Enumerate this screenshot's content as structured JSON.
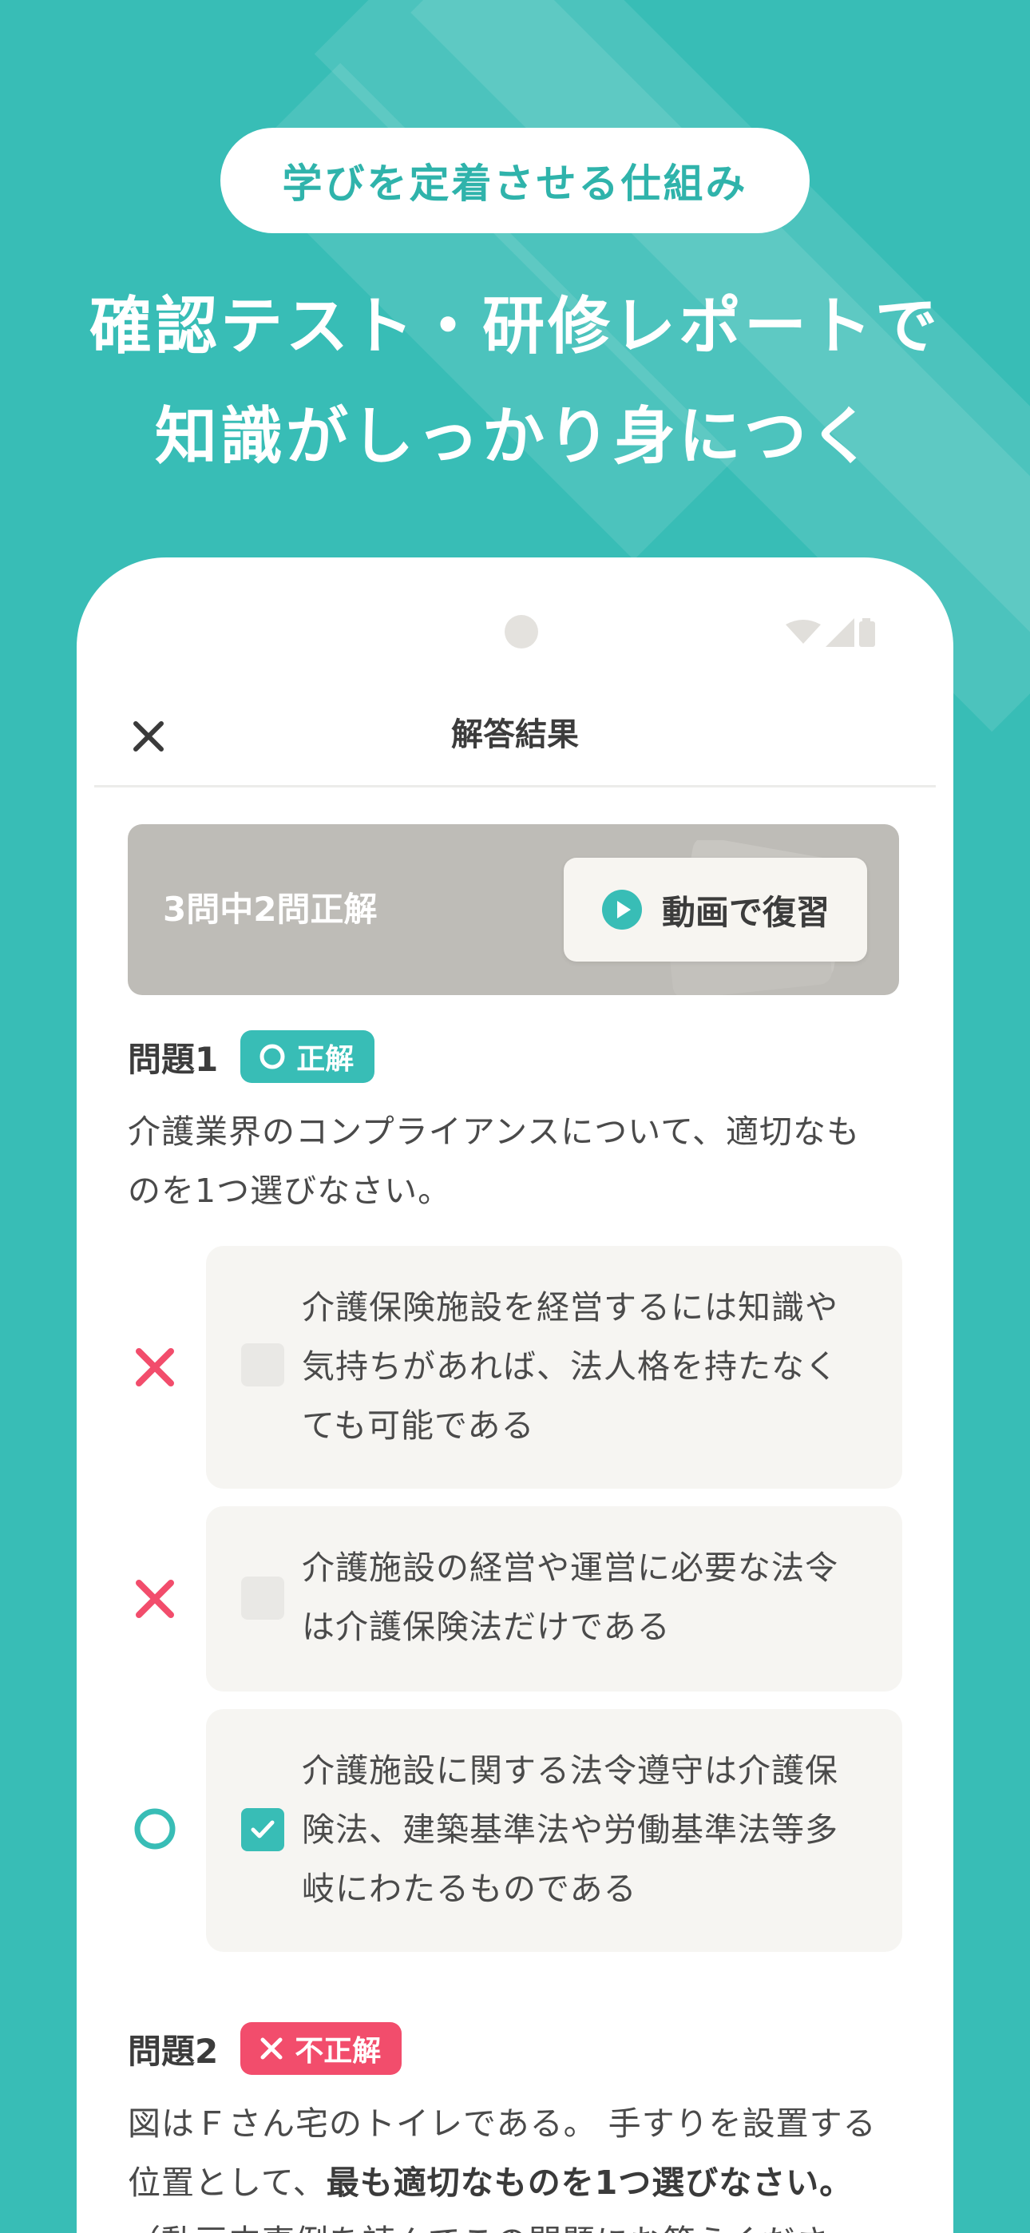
{
  "promo": {
    "pill_label": "学びを定着させる仕組み",
    "headline_line1": "確認テスト・研修レポートで",
    "headline_line2": "知識がしっかり身につく"
  },
  "app": {
    "header_title": "解答結果",
    "score_text": "3問中2問正解",
    "review_button_label": "動画で復習"
  },
  "questions": [
    {
      "title": "問題1",
      "badge_label": "正解",
      "badge_status": "correct",
      "text_line1": "介護業界のコンプライアンスについて、適切なも",
      "text_line2": "のを1つ選びなさい。",
      "options": [
        {
          "mark": "incorrect",
          "checked": false,
          "line1": "介護保険施設を経営するには知識や",
          "line2": "気持ちがあれば、法人格を持たなく",
          "line3": "ても可能である"
        },
        {
          "mark": "incorrect",
          "checked": false,
          "line1": "介護施設の経営や運営に必要な法令",
          "line2": "は介護保険法だけである"
        },
        {
          "mark": "correct",
          "checked": true,
          "line1": "介護施設に関する法令遵守は介護保",
          "line2": "険法、建築基準法や労働基準法等多",
          "line3": "岐にわたるものである"
        }
      ]
    },
    {
      "title": "問題2",
      "badge_label": "不正解",
      "badge_status": "incorrect",
      "text_line1": "図はＦさん宅のトイレである。 手すりを設置する",
      "text_line2_plain": "位置として、",
      "text_line2_bold": "最も適切なものを1つ選びなさい。",
      "text_line3": "（動画内事例を読んでこの問題にお答えくださ"
    }
  ],
  "colors": {
    "background": "#38bdb6",
    "accent": "#38bdb6",
    "incorrect": "#f24d6c",
    "score_card": "#bebcb7",
    "option_bg": "#f6f5f2"
  },
  "icons": {
    "close": "close-icon",
    "play": "play-icon",
    "correct": "circle-icon",
    "incorrect": "cross-icon",
    "check": "check-icon",
    "wifi": "wifi-icon",
    "signal": "signal-icon",
    "battery": "battery-icon"
  }
}
